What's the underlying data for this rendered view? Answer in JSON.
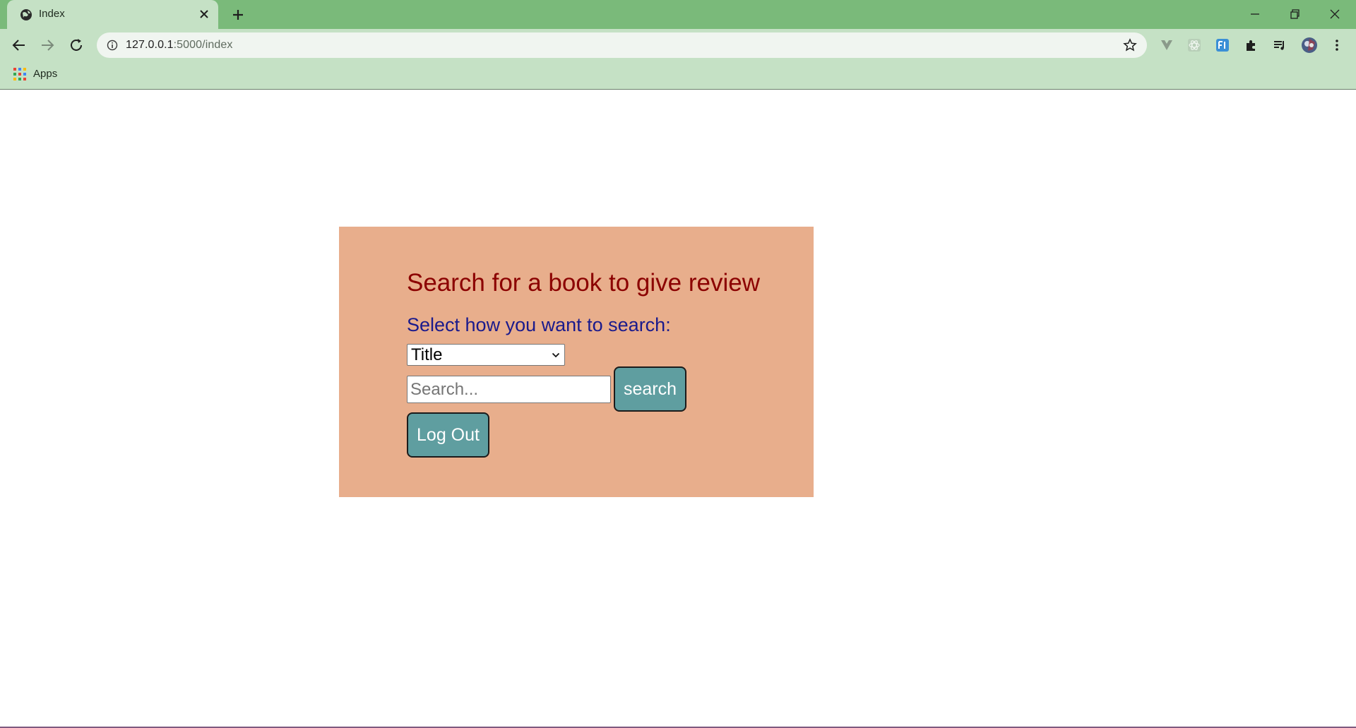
{
  "browser": {
    "tab": {
      "title": "Index"
    },
    "address_bar": {
      "host": "127.0.0.1",
      "path": ":5000/index"
    },
    "bookmarks": {
      "apps_label": "Apps"
    }
  },
  "page": {
    "heading": "Search for a book to give review",
    "select_label": "Select how you want to search:",
    "search_by": {
      "selected": "Title"
    },
    "search_input": {
      "value": "",
      "placeholder": "Search..."
    },
    "search_button_label": "search",
    "logout_button_label": "Log Out"
  },
  "colors": {
    "tabstrip": "#7aba7a",
    "toolbar": "#c5e1c5",
    "card_background": "#e8ae8c",
    "heading": "#8b0000",
    "label": "#1a1a8c",
    "button_background": "#5f9ea0"
  }
}
